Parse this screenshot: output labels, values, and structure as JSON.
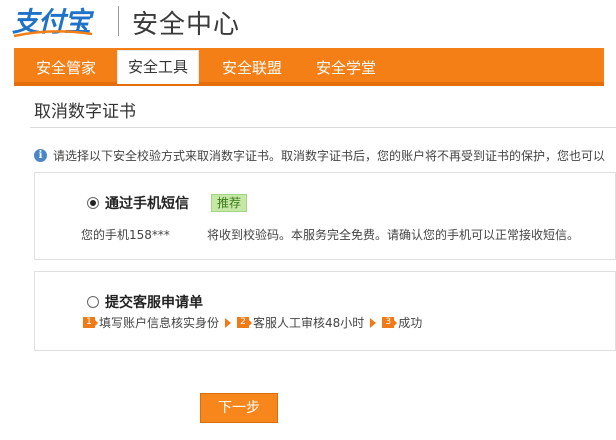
{
  "header": {
    "logo_text": "支付宝",
    "title": "安全中心",
    "brand_color": "#1e73c8",
    "accent_color": "#f57f17"
  },
  "nav": {
    "tabs": [
      {
        "label": "安全管家",
        "active": false
      },
      {
        "label": "安全工具",
        "active": true
      },
      {
        "label": "安全联盟",
        "active": false
      },
      {
        "label": "安全学堂",
        "active": false
      }
    ]
  },
  "main": {
    "section_title": "取消数字证书",
    "info_icon": "info-icon",
    "info_text": "请选择以下安全校验方式来取消数字证书。取消数字证书后，您的账户将不再受到证书的保护，您也可以",
    "options": {
      "sms": {
        "label": "通过手机短信",
        "selected": true,
        "badge": "推荐",
        "desc_prefix": "您的手机158***",
        "desc_suffix": "将收到校验码。本服务完全免费。请确认您的手机可以正常接收短信。"
      },
      "service": {
        "label": "提交客服申请单",
        "selected": false,
        "steps": [
          {
            "num": "1",
            "text": "填写账户信息核实身份"
          },
          {
            "num": "2",
            "text": "客服人工审核48小时"
          },
          {
            "num": "3",
            "text": "成功"
          }
        ]
      }
    },
    "next_button": "下一步"
  }
}
